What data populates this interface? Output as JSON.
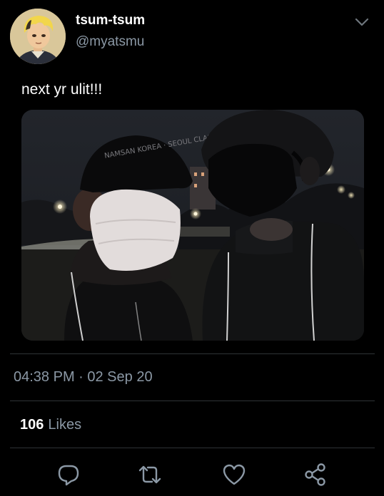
{
  "author": {
    "display_name": "tsum-tsum",
    "handle": "@myatsmu"
  },
  "tweet": {
    "text": "next yr ulit!!!",
    "timestamp": "04:38 PM · 02 Sep 20"
  },
  "stats": {
    "likes_count": "106",
    "likes_label": "Likes"
  },
  "photo": {
    "cap_text": "NAMSAN KOREA · SEOUL CLASSICS"
  },
  "icons": {
    "menu": "chevron-down-icon",
    "reply": "reply-icon",
    "retweet": "retweet-icon",
    "like": "heart-icon",
    "share": "share-icon"
  },
  "colors": {
    "background": "#000000",
    "primary_text": "#ffffff",
    "secondary_text": "#8b98a5",
    "divider": "#2f3336"
  }
}
